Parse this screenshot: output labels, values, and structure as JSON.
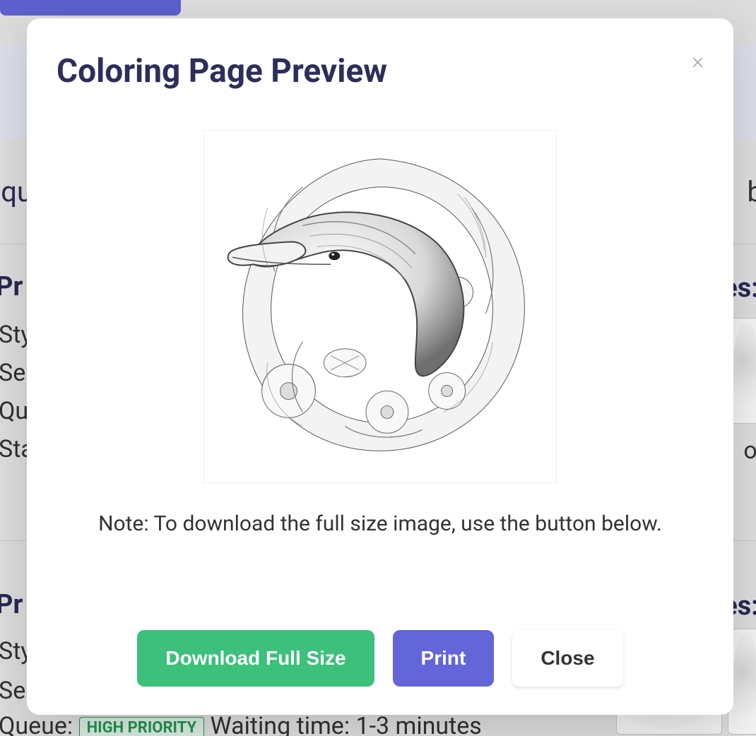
{
  "modal": {
    "title": "Coloring Page Preview",
    "note": "Note: To download the full size image, use the button below.",
    "buttons": {
      "download": "Download Full Size",
      "print": "Print",
      "close": "Close"
    },
    "close_x": "×",
    "preview_alt": "dolphin-with-flowers-coloring-page"
  },
  "background": {
    "left_frag_1": "equ",
    "right_frag_1": "b",
    "section1": {
      "heading_left": "Pr",
      "row1": "Sty",
      "row2": "Se",
      "row3": "Qu",
      "row4": "Sta",
      "heading_right": "es:",
      "row_right": "ol"
    },
    "section2": {
      "heading_left": "Pr",
      "row1": "Sty",
      "row2": "Se",
      "queue_label": "Queue:",
      "badge": "HIGH PRIORITY",
      "wait_text": "Waiting time: 1-3 minutes",
      "heading_right": "es:"
    }
  }
}
